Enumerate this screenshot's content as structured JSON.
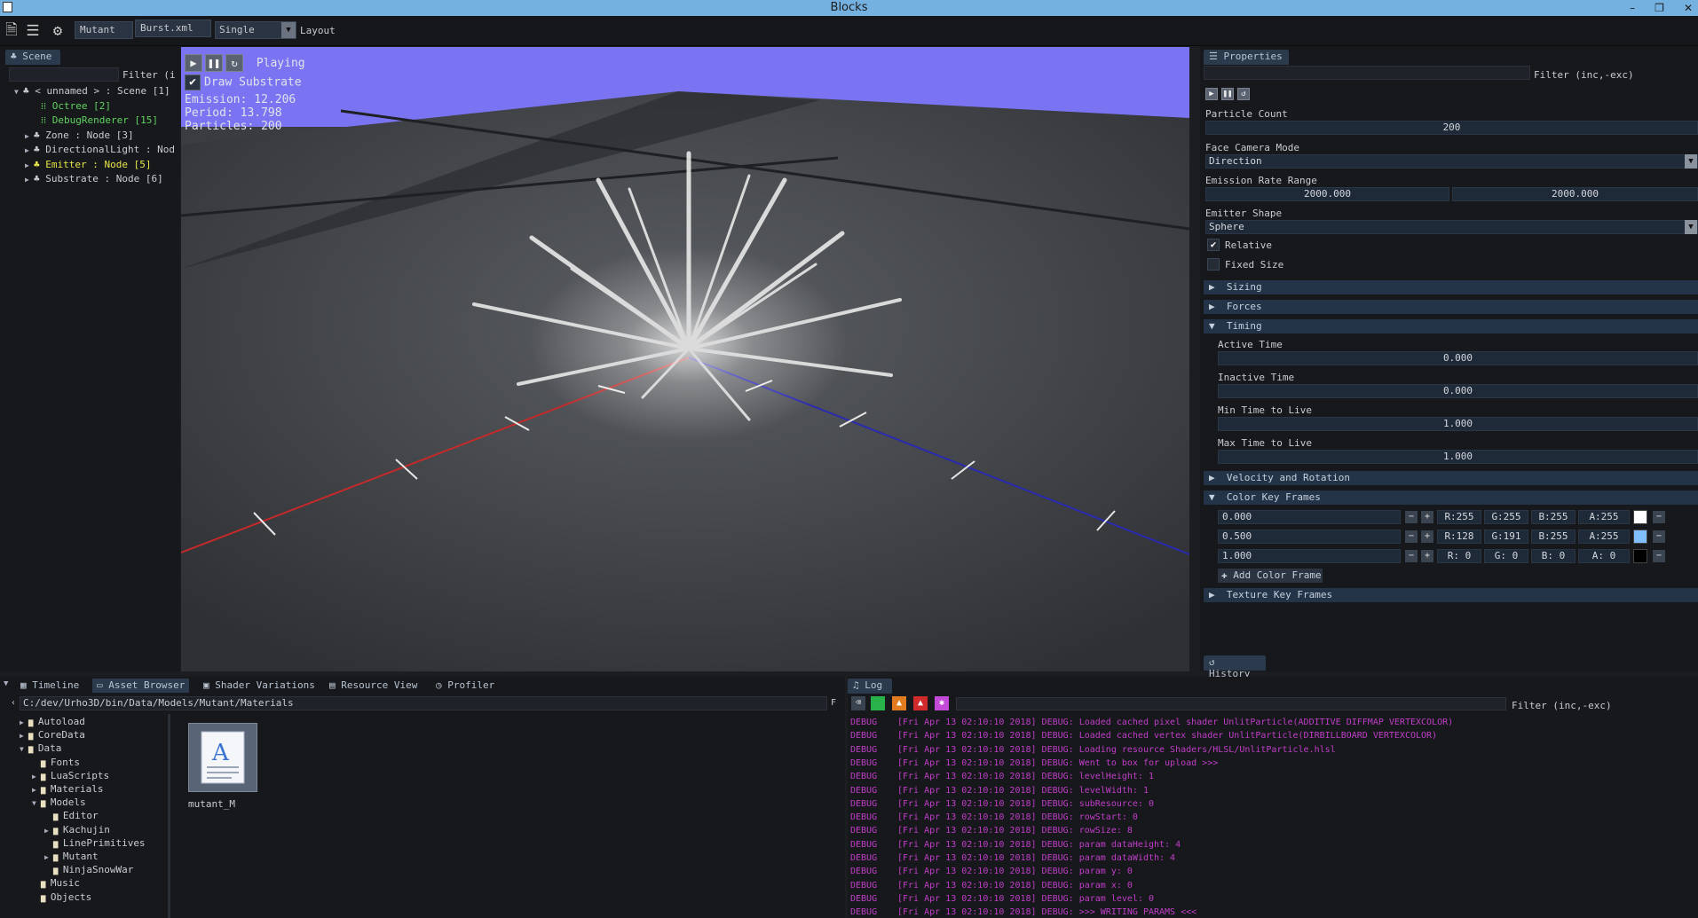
{
  "window": {
    "title": "Blocks"
  },
  "toolbar": {
    "mode": "Mutant",
    "file": "Burst.xml",
    "view": "Single",
    "layout_label": "Layout"
  },
  "scene": {
    "tab": "Scene",
    "filter_placeholder": "Filter (i",
    "items": [
      {
        "label": "< unnamed > : Scene [1]",
        "color": "#c9ccd1"
      },
      {
        "label": "Octree [2]",
        "color": "#5fd35f"
      },
      {
        "label": "DebugRenderer [15]",
        "color": "#5fd35f"
      },
      {
        "label": "Zone : Node [3]",
        "color": "#c9ccd1"
      },
      {
        "label": "DirectionalLight : Nod",
        "color": "#c9ccd1"
      },
      {
        "label": "Emitter : Node [5]",
        "color": "#e6e64a"
      },
      {
        "label": "Substrate : Node [6]",
        "color": "#c9ccd1"
      }
    ]
  },
  "viewport": {
    "status": "Playing",
    "draw_substrate": "Draw Substrate",
    "emission": "Emission: 12.206",
    "period": "Period: 13.798",
    "particles": "Particles: 200",
    "sky_color": "#7a74f2"
  },
  "properties": {
    "tab": "Properties",
    "filter_placeholder": "Filter (inc,-exc)",
    "particle_count_label": "Particle Count",
    "particle_count": "200",
    "face_camera_label": "Face Camera Mode",
    "face_camera": "Direction",
    "emission_rate_label": "Emission Rate Range",
    "emission_min": "2000.000",
    "emission_max": "2000.000",
    "emitter_shape_label": "Emitter Shape",
    "emitter_shape": "Sphere",
    "relative_label": "Relative",
    "fixed_size_label": "Fixed Size",
    "sizing": "Sizing",
    "forces": "Forces",
    "timing": "Timing",
    "active_time_label": "Active Time",
    "active_time": "0.000",
    "inactive_time_label": "Inactive Time",
    "inactive_time": "0.000",
    "min_ttl_label": "Min Time to Live",
    "min_ttl": "1.000",
    "max_ttl_label": "Max Time to Live",
    "max_ttl": "1.000",
    "velocity": "Velocity and Rotation",
    "color_keys": "Color Key Frames",
    "color_frames": [
      {
        "t": "0.000",
        "r": "R:255",
        "g": "G:255",
        "b": "B:255",
        "a": "A:255",
        "swatch": "#ffffff"
      },
      {
        "t": "0.500",
        "r": "R:128",
        "g": "G:191",
        "b": "B:255",
        "a": "A:255",
        "swatch": "#80bfff"
      },
      {
        "t": "1.000",
        "r": "R: 0",
        "g": "G: 0",
        "b": "B: 0",
        "a": "A: 0",
        "swatch": "#000000"
      }
    ],
    "add_color_frame": "Add Color Frame",
    "texture_keys": "Texture Key Frames",
    "history_tab": "History"
  },
  "bottom_tabs": [
    "Timeline",
    "Asset Browser",
    "Shader Variations",
    "Resource View",
    "Profiler"
  ],
  "assets": {
    "path": "C:/dev/Urho3D/bin/Data/Models/Mutant/Materials",
    "tree": [
      {
        "label": "Autoload",
        "depth": 0,
        "arrow": "▶"
      },
      {
        "label": "CoreData",
        "depth": 0,
        "arrow": "▶"
      },
      {
        "label": "Data",
        "depth": 0,
        "arrow": "▼"
      },
      {
        "label": "Fonts",
        "depth": 1,
        "arrow": ""
      },
      {
        "label": "LuaScripts",
        "depth": 1,
        "arrow": "▶"
      },
      {
        "label": "Materials",
        "depth": 1,
        "arrow": "▶"
      },
      {
        "label": "Models",
        "depth": 1,
        "arrow": "▼"
      },
      {
        "label": "Editor",
        "depth": 2,
        "arrow": ""
      },
      {
        "label": "Kachujin",
        "depth": 2,
        "arrow": "▶"
      },
      {
        "label": "LinePrimitives",
        "depth": 2,
        "arrow": ""
      },
      {
        "label": "Mutant",
        "depth": 2,
        "arrow": "▶"
      },
      {
        "label": "NinjaSnowWar",
        "depth": 2,
        "arrow": ""
      },
      {
        "label": "Music",
        "depth": 1,
        "arrow": ""
      },
      {
        "label": "Objects",
        "depth": 1,
        "arrow": ""
      }
    ],
    "file_name": "mutant_M"
  },
  "log": {
    "tab": "Log",
    "filter_placeholder": "Filter (inc,-exc)",
    "lines": [
      {
        "lv": "DEBUG",
        "msg": "[Fri Apr 13 02:10:10 2018] DEBUG: Loaded cached pixel shader UnlitParticle(ADDITIVE DIFFMAP VERTEXCOLOR)"
      },
      {
        "lv": "DEBUG",
        "msg": "[Fri Apr 13 02:10:10 2018] DEBUG: Loaded cached vertex shader UnlitParticle(DIRBILLBOARD VERTEXCOLOR)"
      },
      {
        "lv": "DEBUG",
        "msg": "[Fri Apr 13 02:10:10 2018] DEBUG: Loading resource Shaders/HLSL/UnlitParticle.hlsl"
      },
      {
        "lv": "DEBUG",
        "msg": "[Fri Apr 13 02:10:10 2018] DEBUG: Went to box for upload >>>"
      },
      {
        "lv": "DEBUG",
        "msg": "[Fri Apr 13 02:10:10 2018] DEBUG: levelHeight: 1"
      },
      {
        "lv": "DEBUG",
        "msg": "[Fri Apr 13 02:10:10 2018] DEBUG: levelWidth: 1"
      },
      {
        "lv": "DEBUG",
        "msg": "[Fri Apr 13 02:10:10 2018] DEBUG: subResource: 0"
      },
      {
        "lv": "DEBUG",
        "msg": "[Fri Apr 13 02:10:10 2018] DEBUG: rowStart: 0"
      },
      {
        "lv": "DEBUG",
        "msg": "[Fri Apr 13 02:10:10 2018] DEBUG: rowSize: 8"
      },
      {
        "lv": "DEBUG",
        "msg": "[Fri Apr 13 02:10:10 2018] DEBUG: param dataHeight: 4"
      },
      {
        "lv": "DEBUG",
        "msg": "[Fri Apr 13 02:10:10 2018] DEBUG: param dataWidth: 4"
      },
      {
        "lv": "DEBUG",
        "msg": "[Fri Apr 13 02:10:10 2018] DEBUG: param y: 0"
      },
      {
        "lv": "DEBUG",
        "msg": "[Fri Apr 13 02:10:10 2018] DEBUG: param x: 0"
      },
      {
        "lv": "DEBUG",
        "msg": "[Fri Apr 13 02:10:10 2018] DEBUG: param level: 0"
      },
      {
        "lv": "DEBUG",
        "msg": "[Fri Apr 13 02:10:10 2018] DEBUG: >>> WRITING PARAMS <<<"
      }
    ]
  }
}
